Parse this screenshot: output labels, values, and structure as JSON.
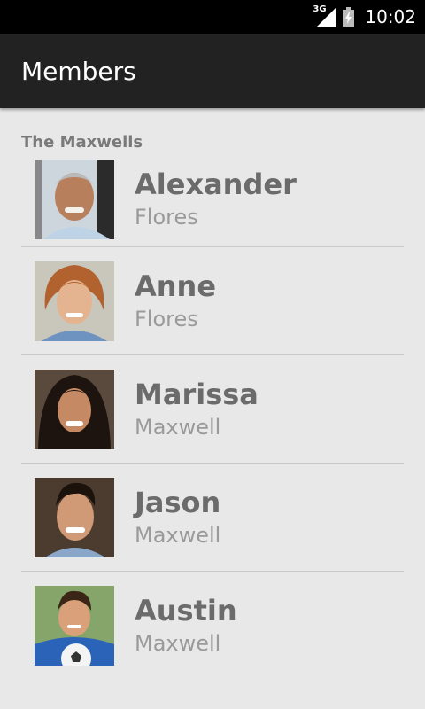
{
  "status_bar": {
    "network": "3G",
    "time": "10:02"
  },
  "app_bar": {
    "title": "Members"
  },
  "section": {
    "header": "The Maxwells"
  },
  "members": [
    {
      "first_name": "Alexander",
      "last_name": "Flores"
    },
    {
      "first_name": "Anne",
      "last_name": "Flores"
    },
    {
      "first_name": "Marissa",
      "last_name": "Maxwell"
    },
    {
      "first_name": "Jason",
      "last_name": "Maxwell"
    },
    {
      "first_name": "Austin",
      "last_name": "Maxwell"
    }
  ],
  "colors": {
    "status_bar": "#000000",
    "app_bar": "#222222",
    "background": "#e8e8e8",
    "divider": "#c9c9c9",
    "first_name": "#6b6b6b",
    "last_name": "#9a9a9a"
  }
}
